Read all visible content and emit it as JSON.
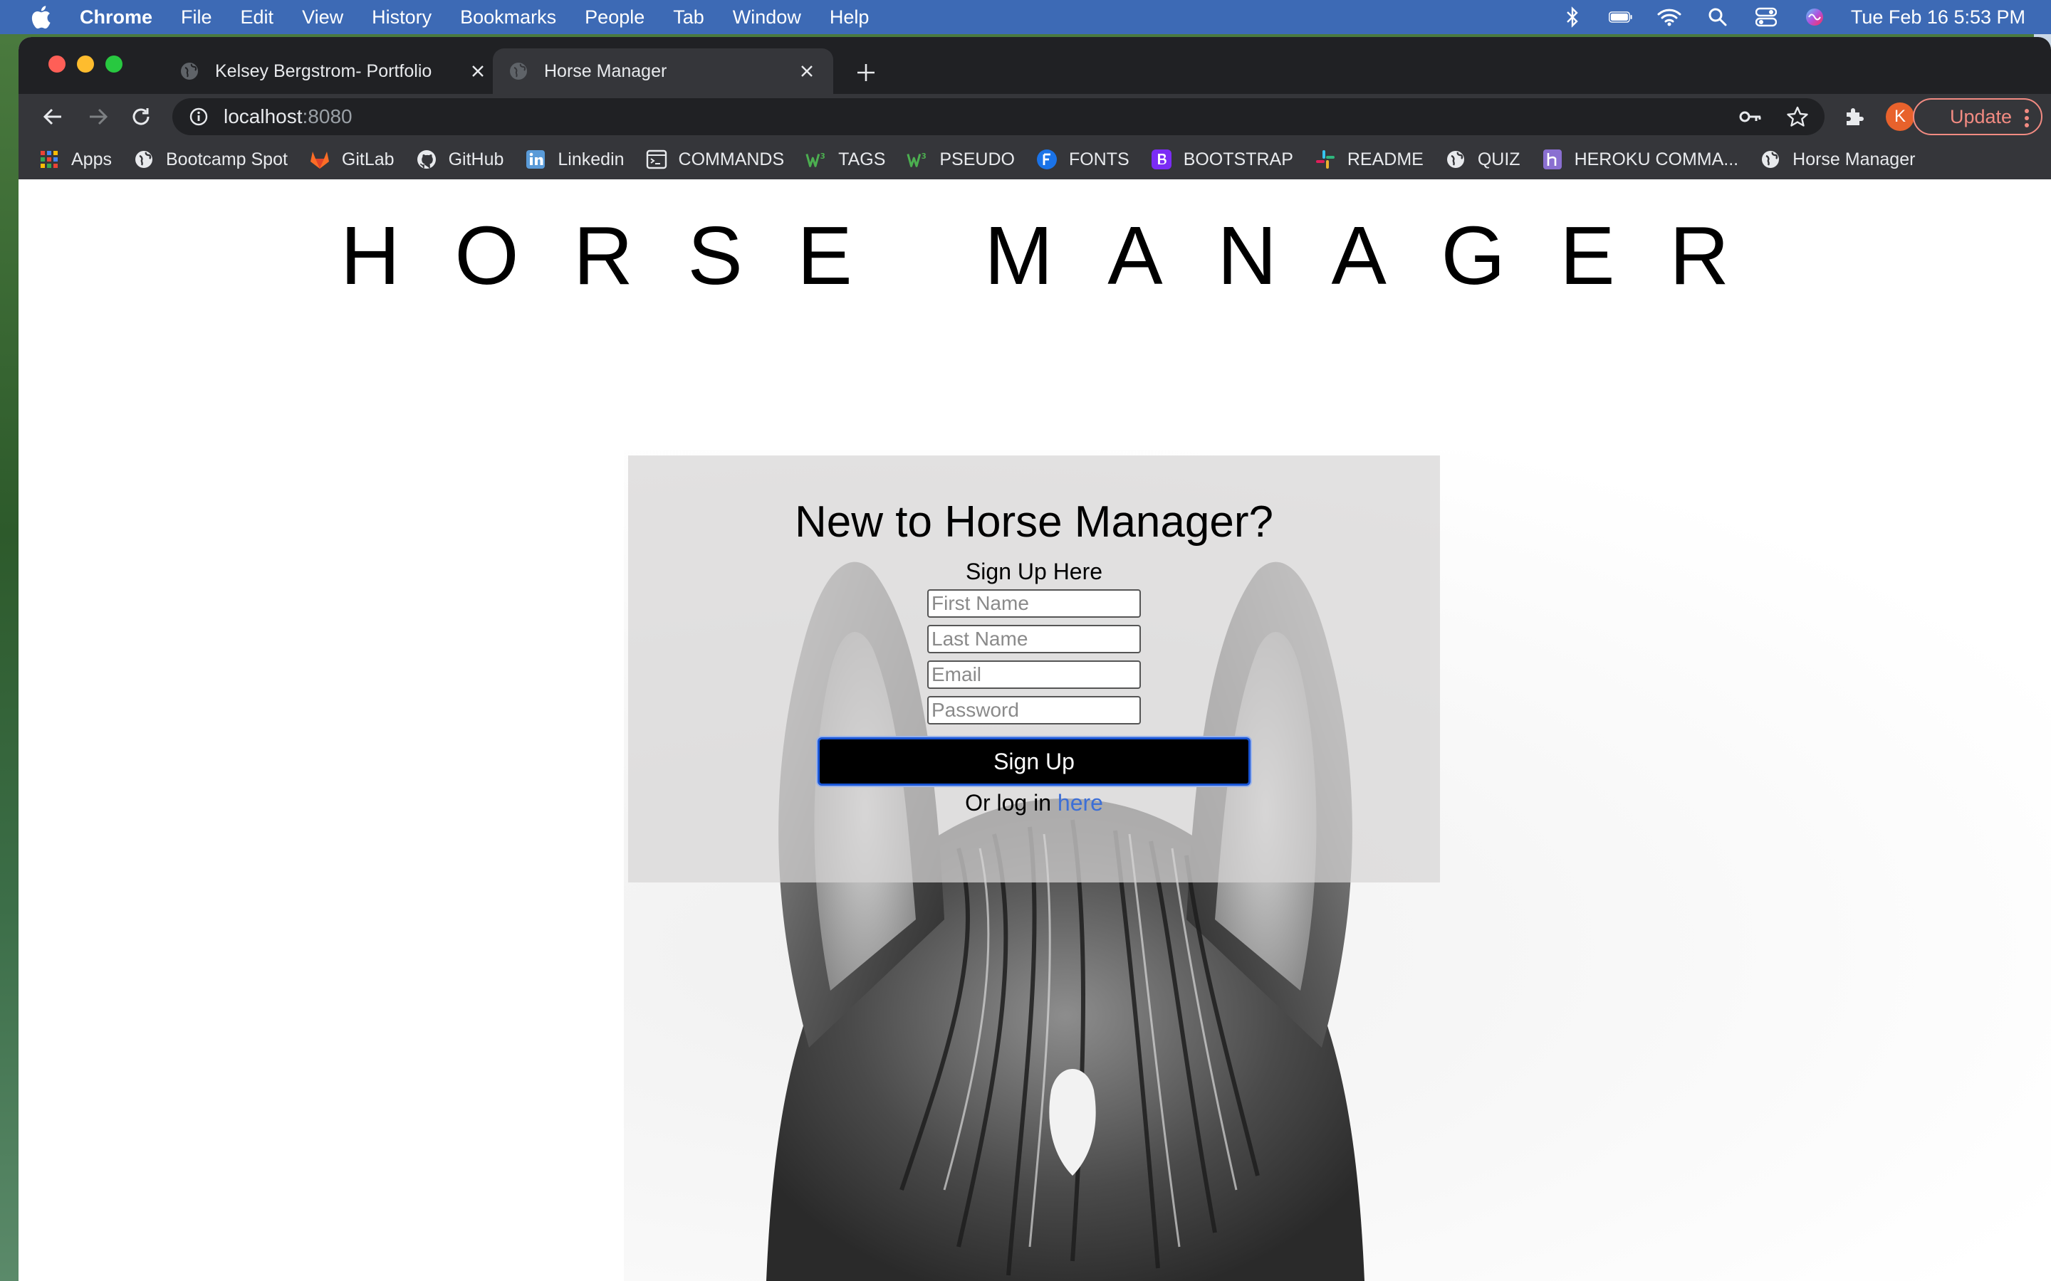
{
  "menubar": {
    "app_name": "Chrome",
    "menus": [
      "File",
      "Edit",
      "View",
      "History",
      "Bookmarks",
      "People",
      "Tab",
      "Window",
      "Help"
    ],
    "clock": "Tue Feb 16  5:53 PM"
  },
  "browser": {
    "tabs": [
      {
        "title": "Kelsey Bergstrom- Portfolio",
        "active": false
      },
      {
        "title": "Horse Manager",
        "active": true
      }
    ],
    "url_host": "localhost",
    "url_port": ":8080",
    "profile_initial": "K",
    "update_label": "Update",
    "bookmarks": [
      {
        "label": "Apps",
        "icon": "apps-grid-icon"
      },
      {
        "label": "Bootcamp Spot",
        "icon": "globe-icon"
      },
      {
        "label": "GitLab",
        "icon": "gitlab-icon"
      },
      {
        "label": "GitHub",
        "icon": "github-icon"
      },
      {
        "label": "Linkedin",
        "icon": "linkedin-icon"
      },
      {
        "label": "COMMANDS",
        "icon": "terminal-icon"
      },
      {
        "label": "TAGS",
        "icon": "w3schools-icon"
      },
      {
        "label": "PSEUDO",
        "icon": "w3schools-icon"
      },
      {
        "label": "FONTS",
        "icon": "fonts-icon"
      },
      {
        "label": "BOOTSTRAP",
        "icon": "bootstrap-icon"
      },
      {
        "label": "README",
        "icon": "slack-icon"
      },
      {
        "label": "QUIZ",
        "icon": "globe-icon"
      },
      {
        "label": "HEROKU COMMA...",
        "icon": "heroku-icon"
      },
      {
        "label": "Horse Manager",
        "icon": "globe-icon"
      }
    ]
  },
  "page": {
    "site_title": "HORSE MANAGER",
    "signup": {
      "heading": "New to Horse Manager?",
      "subheading": "Sign Up Here",
      "first_name_placeholder": "First Name",
      "last_name_placeholder": "Last Name",
      "email_placeholder": "Email",
      "password_placeholder": "Password",
      "button_label": "Sign Up",
      "login_prefix": "Or log in ",
      "login_link": "here"
    }
  },
  "colors": {
    "menubar_bg": "#3d6ab5",
    "chrome_dark": "#202124",
    "chrome_toolbar": "#35363a",
    "link_blue": "#3d6fd6",
    "button_bg": "#000000",
    "button_focus_border": "#1a56d6",
    "update_accent": "#f28b82"
  }
}
